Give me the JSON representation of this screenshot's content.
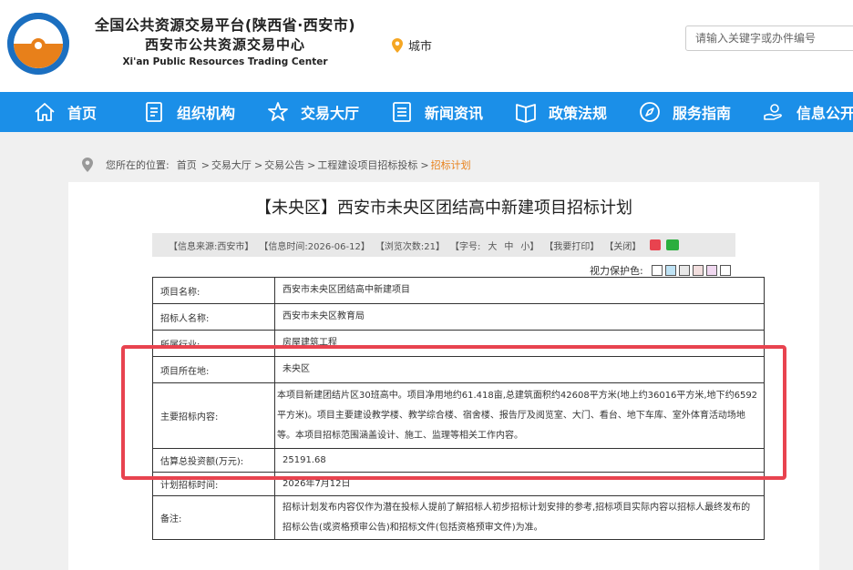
{
  "header": {
    "title_cn_1": "全国公共资源交易平台(陕西省·西安市)",
    "title_cn_2": "西安市公共资源交易中心",
    "title_en": "Xi'an Public Resources Trading Center",
    "city_label": "城市",
    "search_placeholder": "请输入关键字或办件编号"
  },
  "nav": {
    "items": [
      {
        "label": "首页",
        "icon": "home-icon"
      },
      {
        "label": "组织机构",
        "icon": "document-icon"
      },
      {
        "label": "交易大厅",
        "icon": "star-icon"
      },
      {
        "label": "新闻资讯",
        "icon": "list-icon"
      },
      {
        "label": "政策法规",
        "icon": "book-icon"
      },
      {
        "label": "服务指南",
        "icon": "compass-icon"
      },
      {
        "label": "信息公开",
        "icon": "hand-icon"
      }
    ]
  },
  "breadcrumb": {
    "prefix": "您所在的位置:",
    "crumbs": [
      "首页",
      "交易大厅",
      "交易公告",
      "工程建设项目招标投标"
    ],
    "current": "招标计划",
    "sep": ">"
  },
  "article": {
    "title": "【未央区】西安市未央区团结高中新建项目招标计划",
    "info": {
      "source": "【信息来源:西安市】",
      "time": "【信息时间:2026-06-12】",
      "views": "【浏览次数:21】",
      "font_label": "【字号:",
      "font_large": "大",
      "font_medium": "中",
      "font_small": "小】",
      "print": "【我要打印】",
      "close": "【关闭】"
    },
    "eye_label": "视力保护色:",
    "eye_colors": [
      "#ffffff",
      "#bfe3f5",
      "#e8e8e8",
      "#f2dede",
      "#f0d8f0",
      "#ffffff"
    ],
    "rows": [
      {
        "label": "项目名称:",
        "value": "西安市未央区团结高中新建项目"
      },
      {
        "label": "招标人名称:",
        "value": "西安市未央区教育局"
      },
      {
        "label": "所属行业:",
        "value": "房屋建筑工程"
      },
      {
        "label": "项目所在地:",
        "value": "未央区"
      },
      {
        "label": "主要招标内容:",
        "value": "本项目新建团结片区30班高中。项目净用地约61.418亩,总建筑面积约42608平方米(地上约36016平方米,地下约6592平方米)。项目主要建设教学楼、教学综合楼、宿舍楼、报告厅及阅览室、大门、看台、地下车库、室外体育活动场地等。本项目招标范围涵盖设计、施工、监理等相关工作内容。"
      },
      {
        "label": "估算总投资额(万元):",
        "value": "25191.68"
      },
      {
        "label": "计划招标时间:",
        "value": "2026年7月12日"
      },
      {
        "label": "备注:",
        "value": "招标计划发布内容仅作为潜在投标人提前了解招标人初步招标计划安排的参考,招标项目实际内容以招标人最终发布的招标公告(或资格预审公告)和招标文件(包括资格预审文件)为准。"
      }
    ]
  },
  "colors": {
    "nav_bg": "#1b8fe8",
    "logo_orange": "#e8801a",
    "logo_blue": "#1b6fc0",
    "breadcrumb_active": "#e8801a",
    "highlight_box": "#e8434f"
  }
}
